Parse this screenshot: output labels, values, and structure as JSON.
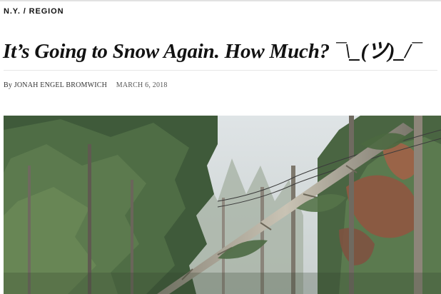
{
  "section": {
    "label": "N.Y. / REGION"
  },
  "article": {
    "headline": "It’s Going to Snow Again. How Much? ¯\\_(ツ)_/¯",
    "byline_prefix": "By",
    "author": "JONAH ENGEL BROMWICH",
    "date": "MARCH 6, 2018"
  },
  "photo": {
    "description_icon": "photo-image"
  }
}
